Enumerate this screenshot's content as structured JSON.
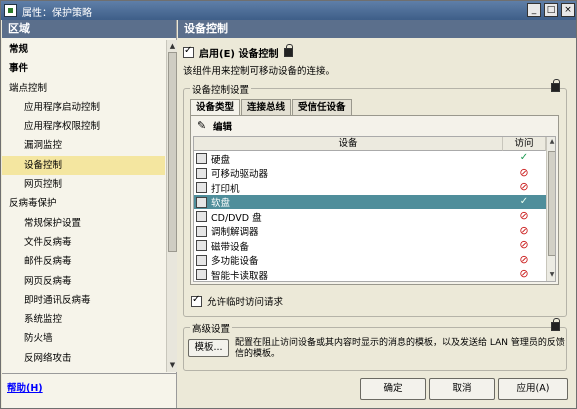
{
  "window": {
    "title": "属性：保护策略",
    "buttons": [
      "_",
      "□",
      "×"
    ]
  },
  "sidebar": {
    "header": "区域",
    "items": [
      {
        "label": "常规",
        "level": 0,
        "bold": true,
        "selected": false
      },
      {
        "label": "事件",
        "level": 0,
        "bold": true,
        "selected": false
      },
      {
        "label": "端点控制",
        "level": 0,
        "bold": false,
        "selected": false
      },
      {
        "label": "应用程序启动控制",
        "level": 1,
        "bold": false,
        "selected": false
      },
      {
        "label": "应用程序权限控制",
        "level": 1,
        "bold": false,
        "selected": false
      },
      {
        "label": "漏洞监控",
        "level": 1,
        "bold": false,
        "selected": false
      },
      {
        "label": "设备控制",
        "level": 1,
        "bold": false,
        "selected": true
      },
      {
        "label": "网页控制",
        "level": 1,
        "bold": false,
        "selected": false
      },
      {
        "label": "反病毒保护",
        "level": 0,
        "bold": false,
        "selected": false
      },
      {
        "label": "常规保护设置",
        "level": 1,
        "bold": false,
        "selected": false
      },
      {
        "label": "文件反病毒",
        "level": 1,
        "bold": false,
        "selected": false
      },
      {
        "label": "邮件反病毒",
        "level": 1,
        "bold": false,
        "selected": false
      },
      {
        "label": "网页反病毒",
        "level": 1,
        "bold": false,
        "selected": false
      },
      {
        "label": "即时通讯反病毒",
        "level": 1,
        "bold": false,
        "selected": false
      },
      {
        "label": "系统监控",
        "level": 1,
        "bold": false,
        "selected": false
      },
      {
        "label": "防火墙",
        "level": 1,
        "bold": false,
        "selected": false
      },
      {
        "label": "反网络攻击",
        "level": 1,
        "bold": false,
        "selected": false
      }
    ],
    "help_link": "帮助(H)"
  },
  "content": {
    "header": "设备控制",
    "enable_label": "启用(E) 设备控制",
    "enable_checked": true,
    "description": "该组件用来控制可移动设备的连接。",
    "settings_group_title": "设备控制设置",
    "tabs": [
      "设备类型",
      "连接总线",
      "受信任设备"
    ],
    "active_tab": 0,
    "edit_label": "编辑",
    "table": {
      "headers": [
        "设备",
        "访问"
      ],
      "rows": [
        {
          "device": "硬盘",
          "icon": "hard-disk-icon",
          "access": "allow"
        },
        {
          "device": "可移动驱动器",
          "icon": "removable-drive-icon",
          "access": "deny"
        },
        {
          "device": "打印机",
          "icon": "printer-icon",
          "access": "deny"
        },
        {
          "device": "软盘",
          "icon": "floppy-icon",
          "access": "allow",
          "selected": true
        },
        {
          "device": "CD/DVD 盘",
          "icon": "cd-dvd-icon",
          "access": "deny"
        },
        {
          "device": "调制解调器",
          "icon": "modem-icon",
          "access": "deny"
        },
        {
          "device": "磁带设备",
          "icon": "tape-icon",
          "access": "deny"
        },
        {
          "device": "多功能设备",
          "icon": "multifunction-device-icon",
          "access": "deny"
        },
        {
          "device": "智能卡读取器",
          "icon": "smart-card-reader-icon",
          "access": "deny"
        }
      ]
    },
    "allow_temp_label": "允许临时访问请求",
    "allow_temp_checked": true,
    "advanced_group_title": "高级设置",
    "template_button": "模板...",
    "advanced_text": "配置在阻止访问设备或其内容时显示的消息的模板，以及发送给 LAN 管理员的反馈信的模板。"
  },
  "footer": {
    "ok": "确定",
    "cancel": "取消",
    "apply": "应用(A)"
  },
  "colors": {
    "header_bg": "#5b6f8c",
    "selected_nav": "#f4e6a0",
    "selected_row": "#4f8e9b",
    "allow": "#1e9a52",
    "deny": "#c81414"
  }
}
